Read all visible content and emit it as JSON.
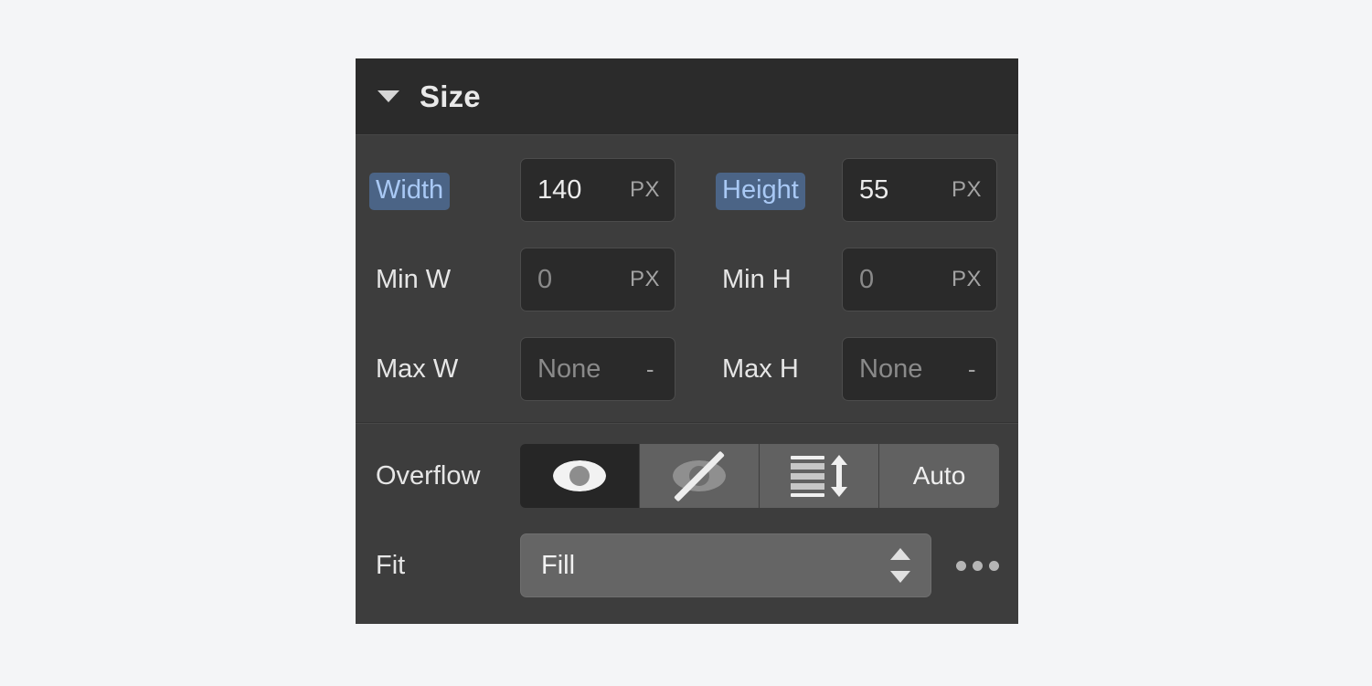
{
  "panel": {
    "title": "Size",
    "disclosure_state": "expanded",
    "colors": {
      "page_background": "#f4f5f7",
      "panel_background": "#3d3d3d",
      "header_background": "#2b2b2b",
      "input_background": "#2a2a2a",
      "segment_background": "#616161",
      "segment_active_background": "#262626",
      "select_background": "#656565",
      "label_highlight_background": "#4b6486",
      "label_highlight_text": "#a9c9f5"
    }
  },
  "size": {
    "rows": [
      {
        "left": {
          "label": "Width",
          "highlighted": true,
          "value": "140",
          "unit": "PX",
          "is_placeholder": false
        },
        "right": {
          "label": "Height",
          "highlighted": true,
          "value": "55",
          "unit": "PX",
          "is_placeholder": false
        }
      },
      {
        "left": {
          "label": "Min W",
          "highlighted": false,
          "value": "0",
          "unit": "PX",
          "is_placeholder": true
        },
        "right": {
          "label": "Min H",
          "highlighted": false,
          "value": "0",
          "unit": "PX",
          "is_placeholder": true
        }
      },
      {
        "left": {
          "label": "Max W",
          "highlighted": false,
          "value": "None",
          "unit": "-",
          "is_placeholder": true
        },
        "right": {
          "label": "Max H",
          "highlighted": false,
          "value": "None",
          "unit": "-",
          "is_placeholder": true
        }
      }
    ]
  },
  "overflow": {
    "label": "Overflow",
    "selected": "visible",
    "options": [
      {
        "name": "visible",
        "icon": "eye-icon",
        "label": ""
      },
      {
        "name": "hidden",
        "icon": "eye-off-icon",
        "label": ""
      },
      {
        "name": "scroll",
        "icon": "scroll-icon",
        "label": ""
      },
      {
        "name": "auto",
        "icon": "",
        "label": "Auto"
      }
    ]
  },
  "fit": {
    "label": "Fit",
    "value": "Fill",
    "more_label": "more-options"
  }
}
